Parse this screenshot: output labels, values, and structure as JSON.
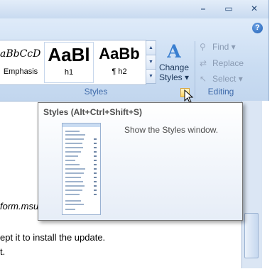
{
  "window": {
    "minimize_icon": "minimize-icon",
    "restore_icon": "restore-icon",
    "close_icon": "close-icon",
    "help_icon": "help-icon",
    "help_label": "?"
  },
  "styles_group": {
    "gallery": [
      {
        "sample": "aBbCcDc",
        "name": "Emphasis"
      },
      {
        "sample": "AaBl",
        "name": "h1"
      },
      {
        "sample": "AaBb",
        "name": "¶ h2"
      }
    ],
    "change_styles_line1": "Change",
    "change_styles_line2": "Styles",
    "label": "Styles"
  },
  "editing_group": {
    "find": "Find",
    "replace": "Replace",
    "select": "Select",
    "label": "Editing"
  },
  "tooltip": {
    "title": "Styles (Alt+Ctrl+Shift+S)",
    "description": "Show the Styles window."
  },
  "document": {
    "line1": "form.msu",
    "line2": "ept it to install the update.",
    "line3": "t."
  },
  "colors": {
    "ribbon": "#c9dcf2",
    "accent": "#3e6aaa"
  }
}
